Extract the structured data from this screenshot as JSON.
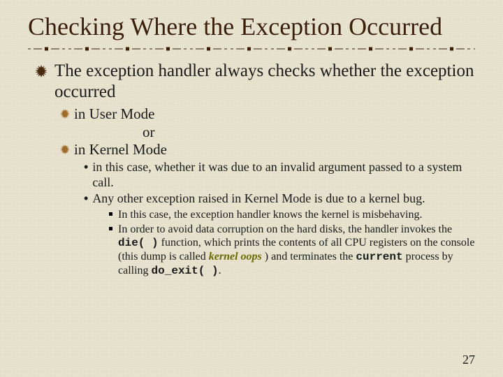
{
  "title": "Checking Where the Exception Occurred",
  "lvl1_text": "The exception handler always checks whether the exception occurred",
  "lvl2_a": "in User Mode",
  "or": "or",
  "lvl2_b": "in Kernel Mode",
  "lvl3_a": "in this case, whether it was due to an invalid argument passed to a system call.",
  "lvl3_b": "Any other exception raised in Kernel Mode is due to a kernel bug.",
  "lvl4_a": "In this case, the exception handler knows the kernel is misbehaving.",
  "lvl4_b_1": "In order to avoid data corruption on the hard disks, the handler invokes the ",
  "lvl4_b_die": "die( )",
  "lvl4_b_2": " function, which prints the contents of all CPU registers on the console (this dump is called ",
  "lvl4_b_oops": "kernel oops",
  "lvl4_b_3": " ) and terminates the ",
  "lvl4_b_current": "current",
  "lvl4_b_4": " process by calling ",
  "lvl4_b_doexit": "do_exit( )",
  "lvl4_b_5": ".",
  "page": "27"
}
